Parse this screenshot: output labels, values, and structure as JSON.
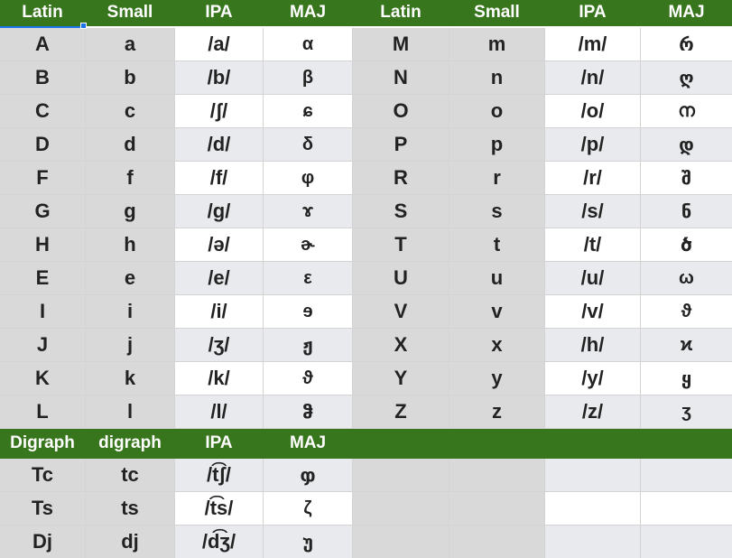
{
  "headers": [
    "Latin",
    "Small",
    "IPA",
    "MAJ",
    "Latin",
    "Small",
    "IPA",
    "MAJ"
  ],
  "rows": [
    {
      "l1": "A",
      "s1": "a",
      "i1": "/a/",
      "m1": "α",
      "l2": "M",
      "s2": "m",
      "i2": "/m/",
      "m2": "რ"
    },
    {
      "l1": "B",
      "s1": "b",
      "i1": "/b/",
      "m1": "β",
      "l2": "N",
      "s2": "n",
      "i2": "/n/",
      "m2": "ღ"
    },
    {
      "l1": "C",
      "s1": "c",
      "i1": "/ʃ/",
      "m1": "ɕ",
      "l2": "O",
      "s2": "o",
      "i2": "/o/",
      "m2": "ന"
    },
    {
      "l1": "D",
      "s1": "d",
      "i1": "/d/",
      "m1": "δ",
      "l2": "P",
      "s2": "p",
      "i2": "/p/",
      "m2": "დ"
    },
    {
      "l1": "F",
      "s1": "f",
      "i1": "/f/",
      "m1": "φ",
      "l2": "R",
      "s2": "r",
      "i2": "/r/",
      "m2": "შ"
    },
    {
      "l1": "G",
      "s1": "g",
      "i1": "/g/",
      "m1": "ɤ",
      "l2": "S",
      "s2": "s",
      "i2": "/s/",
      "m2": "ნ"
    },
    {
      "l1": "H",
      "s1": "h",
      "i1": "/ə/",
      "m1": "ɚ",
      "l2": "T",
      "s2": "t",
      "i2": "/t/",
      "m2": "ծ"
    },
    {
      "l1": "E",
      "s1": "e",
      "i1": "/e/",
      "m1": "ε",
      "l2": "U",
      "s2": "u",
      "i2": "/u/",
      "m2": "ω"
    },
    {
      "l1": "I",
      "s1": "i",
      "i1": "/i/",
      "m1": "ɘ",
      "l2": "V",
      "s2": "v",
      "i2": "/v/",
      "m2": "ϑ"
    },
    {
      "l1": "J",
      "s1": "j",
      "i1": "/ʒ/",
      "m1": "ჟ",
      "l2": "X",
      "s2": "x",
      "i2": "/h/",
      "m2": "ϰ"
    },
    {
      "l1": "K",
      "s1": "k",
      "i1": "/k/",
      "m1": "ϑ",
      "l2": "Y",
      "s2": "y",
      "i2": "/y/",
      "m2": "ყ"
    },
    {
      "l1": "L",
      "s1": "l",
      "i1": "/l/",
      "m1": "ჵ",
      "l2": "Z",
      "s2": "z",
      "i2": "/z/",
      "m2": "ʒ"
    }
  ],
  "digraph_headers": [
    "Digraph",
    "digraph",
    "IPA",
    "MAJ"
  ],
  "digraph_rows": [
    {
      "l": "Tc",
      "s": "tc",
      "i": "/t͡ʃ/",
      "m": "ჶ"
    },
    {
      "l": "Ts",
      "s": "ts",
      "i": "/t͡s/",
      "m": "ζ"
    },
    {
      "l": "Dj",
      "s": "dj",
      "i": "/d͡ʒ/",
      "m": "უ"
    }
  ],
  "colors": {
    "header_green": "#38761d",
    "col_gray": "#d9d9d9",
    "row_alt": "#e8eaed",
    "selection": "#1a73e8"
  }
}
